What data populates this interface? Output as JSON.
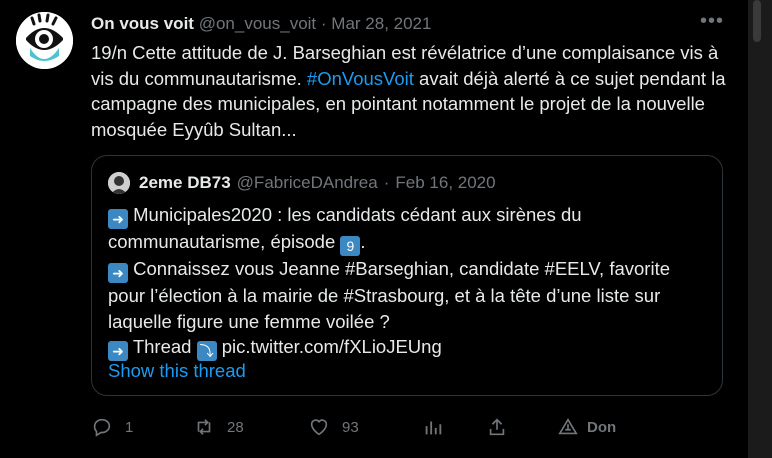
{
  "tweet": {
    "author_name": "On vous voit",
    "handle": "@on_vous_voit",
    "separator": "·",
    "date": "Mar 28, 2021",
    "more_label": "•••",
    "text_before_hashtag": "19/n Cette attitude de J. Barseghian est révélatrice d’une complaisance vis à vis du communautarisme. ",
    "hashtag": "#OnVousVoit",
    "text_after_hashtag": " avait déjà alerté à ce sujet pendant la campagne des municipales, en pointant notamment le projet de la nouvelle mosquée Eyyûb Sultan..."
  },
  "quote": {
    "author_name": "2eme DB73",
    "handle": "@FabriceDAndrea",
    "separator": "·",
    "date": "Feb 16, 2020",
    "line1_a": "Municipales2020 : les candidats cédant aux sirènes du communautarisme, épisode ",
    "line1_b": ".",
    "episode_digit": "9",
    "line2": "Connaissez vous Jeanne #Barseghian, candidate #EELV, favorite pour l’élection à la mairie de #Strasbourg, et à la tête d’une liste sur laquelle figure une femme voilée ?",
    "line3": "Thread",
    "line3_link": "pic.twitter.com/fXLioJEUng",
    "show_thread": "Show this thread"
  },
  "actions": {
    "replies": "1",
    "retweets": "28",
    "likes": "93",
    "donate": "Don"
  },
  "icons": [
    "more-icon",
    "arrow-right-icon",
    "keycap-9-icon",
    "arrow-down-icon",
    "reply-icon",
    "retweet-icon",
    "like-icon",
    "analytics-icon",
    "share-icon",
    "donate-icon"
  ],
  "colors": {
    "background": "#000000",
    "text": "#e7e9ea",
    "muted": "#71767b",
    "link": "#1d9bf0",
    "arrow_emoji": "#3b88c3"
  }
}
